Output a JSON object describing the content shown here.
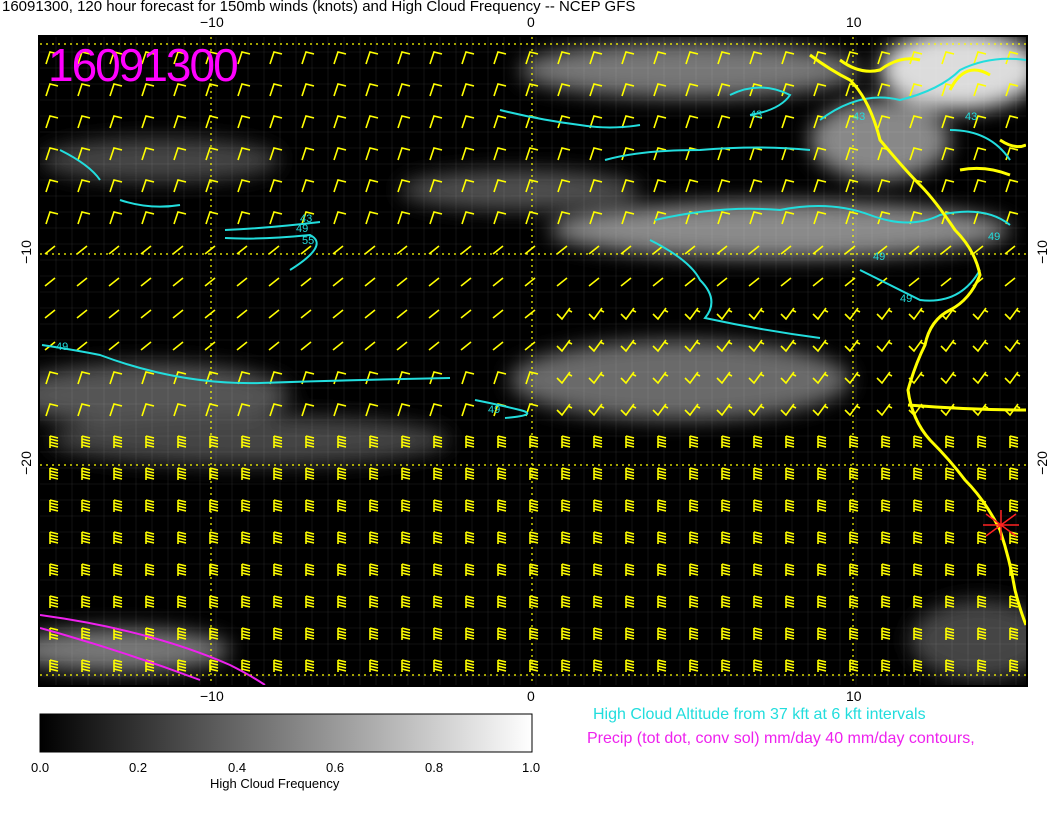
{
  "header": {
    "title": "16091300, 120 hour forecast for 150mb winds (knots) and High Cloud Frequency -- NCEP GFS",
    "stamp": "16091300"
  },
  "axes": {
    "x_ticks": [
      "−10",
      "0",
      "10"
    ],
    "y_ticks": [
      "−10",
      "−20"
    ]
  },
  "contours": {
    "cyan_labels": [
      "43",
      "43",
      "43",
      "43",
      "49",
      "55",
      "49",
      "49",
      "49",
      "49",
      "49"
    ]
  },
  "colorbar": {
    "title": "High Cloud Frequency",
    "ticks": [
      "0.0",
      "0.2",
      "0.4",
      "0.6",
      "0.8",
      "1.0"
    ]
  },
  "legend": {
    "cyan_text": "High Cloud Altitude from 37 kft at 6 kft intervals",
    "magenta_text": "Precip (tot dot, conv sol) mm/day 40 mm/day contours,"
  },
  "colors": {
    "barb": "#ffff00",
    "contour_cyan": "#22dddd",
    "contour_magenta": "#ee22ee",
    "coast": "#ffff00",
    "marker": "#ff2222"
  }
}
